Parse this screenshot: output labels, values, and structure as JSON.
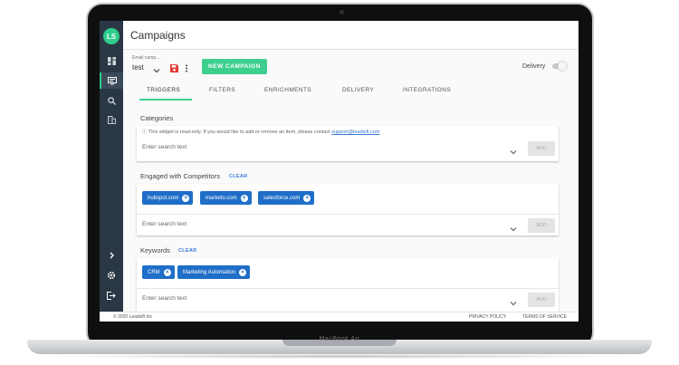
{
  "device": {
    "model_label": "MacBook Air"
  },
  "app": {
    "logo_text": "LS",
    "page_title": "Campaigns"
  },
  "sidebar": {
    "icons": [
      "dashboard-icon",
      "campaigns-icon",
      "search-icon",
      "business-icon"
    ],
    "bottom_icons": [
      "chevron-right-icon",
      "gear-icon",
      "logout-icon"
    ]
  },
  "toolbar": {
    "campaign_select_label": "Email camp...",
    "campaign_select_value": "test",
    "new_campaign_label": "NEW CAMPAIGN",
    "delivery_label": "Delivery",
    "delivery_enabled": false
  },
  "tabs": [
    {
      "label": "TRIGGERS",
      "active": true
    },
    {
      "label": "FILTERS",
      "active": false
    },
    {
      "label": "ENRICHMENTS",
      "active": false
    },
    {
      "label": "DELIVERY",
      "active": false
    },
    {
      "label": "INTEGRATIONS",
      "active": false
    }
  ],
  "categories": {
    "title": "Categories",
    "notice_prefix": "This widget is read-only. If you would like to add or remove an item, please contact ",
    "notice_email": "support@leadsift.com",
    "search_placeholder": "Enter search text",
    "add_label": "ADD"
  },
  "competitors": {
    "title": "Engaged with Competitors",
    "clear_label": "CLEAR",
    "chips": [
      "hubspot.com",
      "marketo.com",
      "salesforce.com"
    ],
    "search_placeholder": "Enter search text",
    "add_label": "ADD"
  },
  "keywords": {
    "title": "Keywords",
    "clear_label": "CLEAR",
    "chips": [
      "CRM",
      "Marketing Automation"
    ],
    "search_placeholder": "Enter search text",
    "add_label": "ADD"
  },
  "footer": {
    "copyright": "© 2020 Leadsift Inc",
    "privacy": "PRIVACY POLICY",
    "terms": "TERMS OF SERVICE"
  },
  "colors": {
    "accent": "#3ecf8e",
    "chip": "#1f6ec8",
    "sidebar": "#2a3744",
    "link": "#3a7bd5"
  }
}
